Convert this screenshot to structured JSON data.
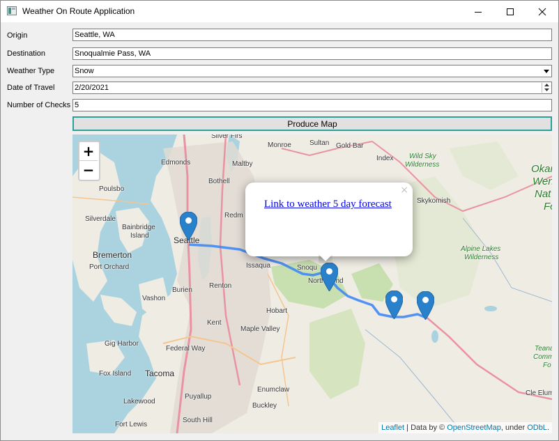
{
  "window": {
    "title": "Weather On Route Application"
  },
  "form": {
    "origin_label": "Origin",
    "origin_value": "Seattle, WA",
    "destination_label": "Destination",
    "destination_value": "Snoqualmie Pass, WA",
    "weather_type_label": "Weather Type",
    "weather_type_value": "Snow",
    "date_label": "Date of Travel",
    "date_value": "2/20/2021",
    "checks_label": "Number of Checks",
    "checks_value": "5",
    "produce_button": "Produce Map"
  },
  "map": {
    "zoom_in": "+",
    "zoom_out": "−",
    "popup": {
      "close": "×",
      "link_text": "Link to weather 5 day forecast"
    },
    "attribution": {
      "leaflet": "Leaflet",
      "sep": " | Data by © ",
      "osm": "OpenStreetMap",
      "under": ", under ",
      "license": "ODbL",
      "end": "."
    },
    "places": {
      "silver_firs": "Silver Firs",
      "monroe": "Monroe",
      "sultan": "Sultan",
      "gold_bar": "Gold Bar",
      "wild_sky": "Wild Sky",
      "wilderness1": "Wilderness",
      "edmonds": "Edmonds",
      "maltby": "Maltby",
      "index": "Index",
      "poulsbo": "Poulsbo",
      "bothell": "Bothell",
      "skykomish": "Skykomish",
      "okan": "Okan",
      "wen": "Wen",
      "nat": "Nat",
      "fo": "Fo",
      "silverdale": "Silverdale",
      "bainbridge": "Bainbridge",
      "island": "Island",
      "redmond": "Redm",
      "seattle": "Seattle",
      "bremerton": "Bremerton",
      "port_orchard": "Port Orchard",
      "alpine_lakes": "Alpine Lakes",
      "wilderness2": "Wilderness",
      "issaquah": "Issaqua",
      "snoqualmie": "Snoqu",
      "north_bend": "North Bend",
      "burien": "Burien",
      "renton": "Renton",
      "vashon": "Vashon",
      "hobart": "Hobart",
      "kent": "Kent",
      "maple_valley": "Maple Valley",
      "gig_harbor": "Gig Harbor",
      "federal_way": "Federal Way",
      "fox_island": "Fox Island",
      "tacoma": "Tacoma",
      "enumclaw": "Enumclaw",
      "puyallup": "Puyallup",
      "lakewood": "Lakewood",
      "buckley": "Buckley",
      "fort_lewis": "Fort Lewis",
      "south_hill": "South Hill",
      "teanaway": "Teana",
      "comm": "Comm",
      "fo2": "Fo",
      "cle_elum": "Cle Elum"
    }
  }
}
